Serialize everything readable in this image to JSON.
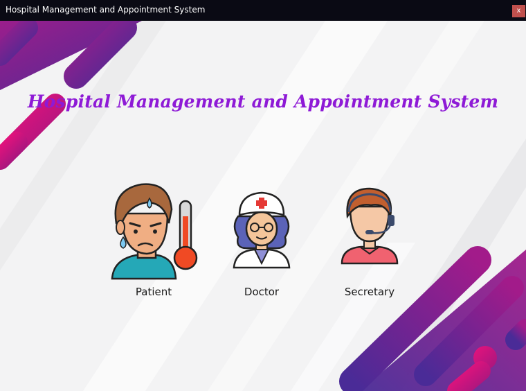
{
  "window": {
    "title": "Hospital Management and Appointment System",
    "close_label": "x"
  },
  "main": {
    "heading": "Hospital Management and Appointment System",
    "roles": [
      {
        "label": "Patient",
        "icon": "sick-patient-icon"
      },
      {
        "label": "Doctor",
        "icon": "nurse-doctor-icon"
      },
      {
        "label": "Secretary",
        "icon": "receptionist-headset-icon"
      }
    ]
  },
  "colors": {
    "heading": "#8e1ad6",
    "titlebar": "#0a0a14",
    "close_button": "#c0504d",
    "accent_purple": "#6a2a9e",
    "accent_pink": "#e0137d"
  }
}
